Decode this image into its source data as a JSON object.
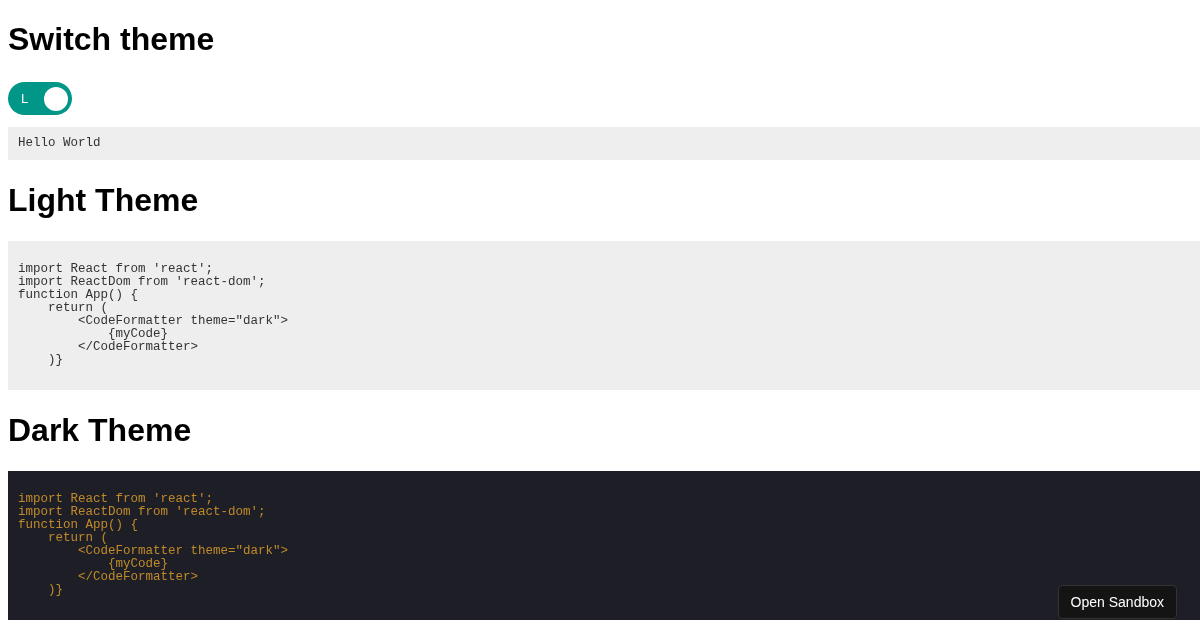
{
  "title": "Switch theme",
  "toggle": {
    "label": "L",
    "on": true
  },
  "preview": {
    "text": "Hello World"
  },
  "sections": [
    {
      "heading": "Light Theme",
      "kind": "light",
      "code": "import React from 'react';\nimport ReactDom from 'react-dom';\nfunction App() {\n    return (\n        <CodeFormatter theme=\"dark\">\n            {myCode}\n        </CodeFormatter>\n    )}"
    },
    {
      "heading": "Dark Theme",
      "kind": "dark",
      "code": "import React from 'react';\nimport ReactDom from 'react-dom';\nfunction App() {\n    return (\n        <CodeFormatter theme=\"dark\">\n            {myCode}\n        </CodeFormatter>\n    )}"
    }
  ],
  "sandbox_button": "Open Sandbox"
}
